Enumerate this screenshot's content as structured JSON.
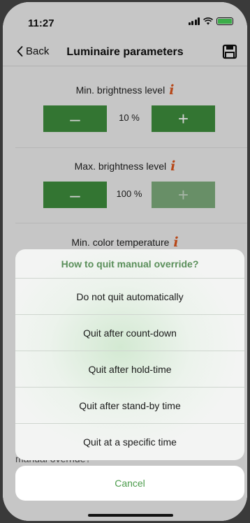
{
  "status_bar": {
    "time": "11:27"
  },
  "nav": {
    "back_label": "Back",
    "title": "Luminaire parameters",
    "save_icon": "floppy-disk-icon"
  },
  "sections": [
    {
      "label": "Min. brightness level",
      "minus": "–",
      "value": "10 %",
      "plus": "+",
      "plus_enabled": true
    },
    {
      "label": "Max. brightness level",
      "minus": "–",
      "value": "100 %",
      "plus": "+",
      "plus_enabled": false
    },
    {
      "label": "Min. color temperature"
    }
  ],
  "info_glyph": "i",
  "action_sheet": {
    "title": "How to quit manual override?",
    "options": [
      "Do not quit automatically",
      "Quit after count-down",
      "Quit after hold-time",
      "Quit after stand-by time",
      "Quit at a specific time"
    ],
    "cancel_label": "Cancel"
  },
  "background_peek_text": "manual override?",
  "colors": {
    "accent_green": "#3f8f3e",
    "disabled_green": "#7faf7e",
    "info_orange": "#e0571e",
    "sheet_title_green": "#5a8f5a",
    "cancel_green": "#4c9c4c"
  }
}
